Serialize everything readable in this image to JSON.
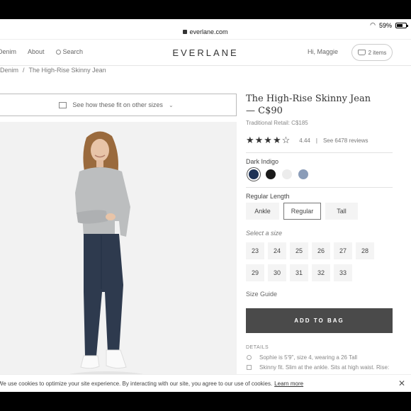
{
  "status": {
    "battery": "59%"
  },
  "url": "everlane.com",
  "nav": {
    "links": [
      "Denim",
      "About",
      "Search"
    ],
    "logo": "EVERLANE",
    "greeting": "Hi, Maggie",
    "cart": "2 items"
  },
  "breadcrumb": {
    "parent": "Denim",
    "sep": "/",
    "current": "The High-Rise Skinny Jean"
  },
  "fit_prompt": "See how these fit on other sizes",
  "product": {
    "title": "The High-Rise Skinny Jean",
    "price_line": "— C$90",
    "retail": "Traditional Retail: C$185",
    "stars": "★★★★☆",
    "rating": "4.44",
    "reviews_sep": "|",
    "reviews": "See 6478 reviews",
    "color_label": "Dark Indigo",
    "swatches": [
      "#1f3356",
      "#1a1a1a",
      "#ececec",
      "#8a9cb8"
    ],
    "length_label": "Regular Length",
    "lengths": [
      "Ankle",
      "Regular",
      "Tall"
    ],
    "size_label": "Select a size",
    "sizes": [
      "23",
      "24",
      "25",
      "26",
      "27",
      "28",
      "29",
      "30",
      "31",
      "32",
      "33"
    ],
    "size_guide": "Size Guide",
    "add_to_bag": "ADD TO BAG",
    "details_heading": "DETAILS",
    "details": [
      "Sophie is 5'9\", size 4, wearing a 26 Tall",
      "Skinny fit. Slim at the ankle. Sits at high waist. Rise:"
    ]
  },
  "cookie": {
    "text": "We use cookies to optimize your site experience. By interacting with our site, you agree to our use of cookies.",
    "link": "Learn more"
  }
}
